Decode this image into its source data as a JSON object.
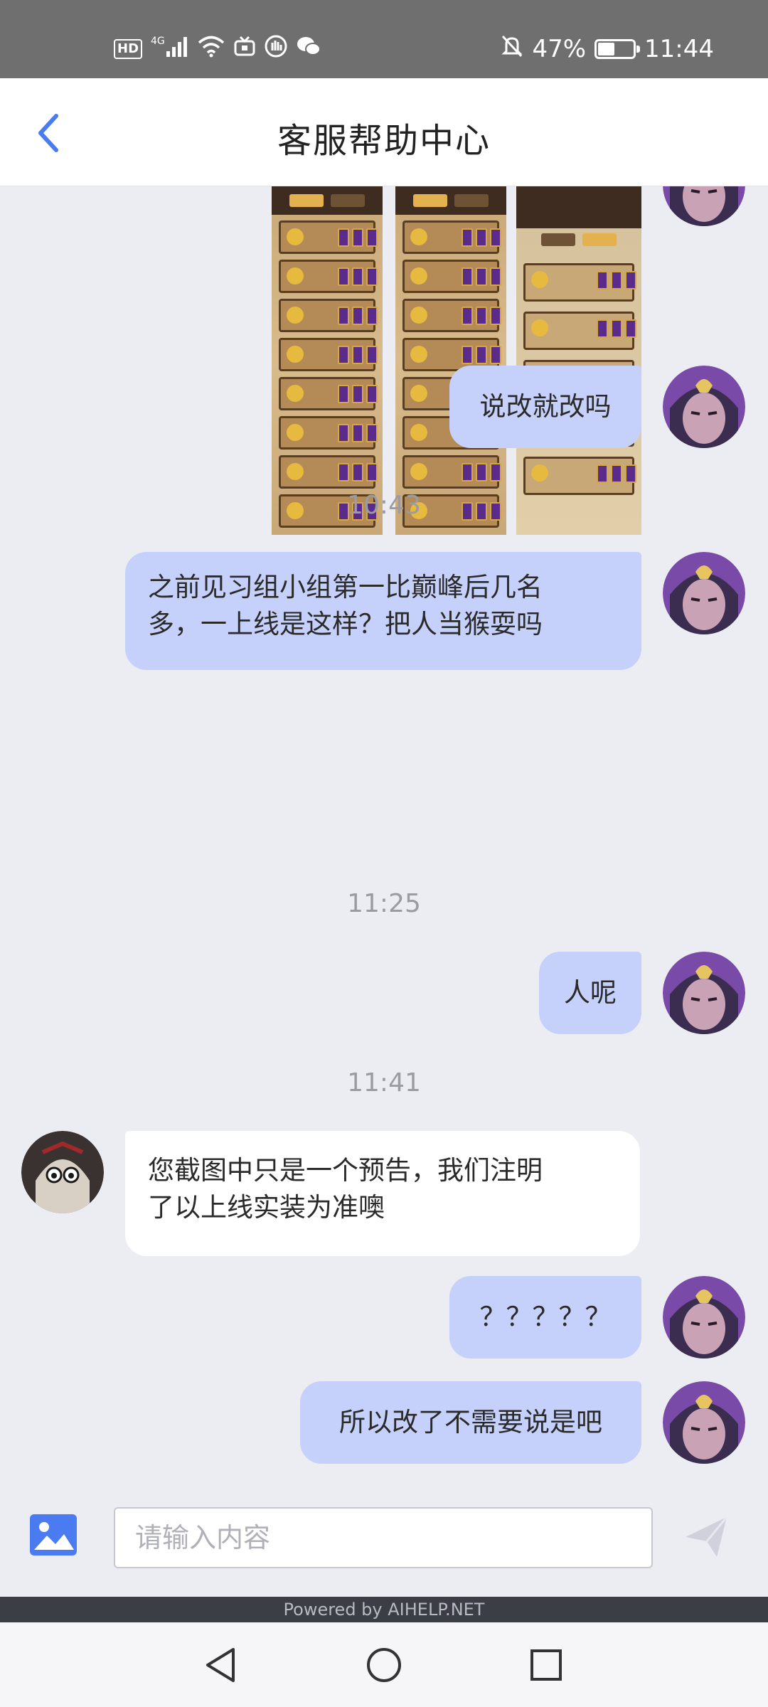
{
  "status_bar": {
    "hd": "HD",
    "network": "4G",
    "battery": "47%",
    "battery_level": 0.47,
    "time": "11:44"
  },
  "header": {
    "title": "客服帮助中心",
    "back_icon": "chevron-left-icon"
  },
  "messages": [
    {
      "type": "image",
      "sender": "user"
    },
    {
      "type": "text",
      "sender": "user",
      "text": "说改就改吗"
    },
    {
      "type": "time",
      "text": "10:43"
    },
    {
      "type": "text",
      "sender": "user",
      "line1": "之前见习组小组第一比巅峰后几名",
      "line2": "多，一上线是这样？把人当猴耍吗"
    },
    {
      "type": "time",
      "text": "11:25"
    },
    {
      "type": "text",
      "sender": "user",
      "text": "人呢"
    },
    {
      "type": "time",
      "text": "11:41"
    },
    {
      "type": "text",
      "sender": "support",
      "line1": "您截图中只是一个预告，我们注明",
      "line2": "了以上线实装为准噢"
    },
    {
      "type": "text",
      "sender": "user",
      "text": "？？？？？"
    },
    {
      "type": "text",
      "sender": "user",
      "text": "所以改了不需要说是吧"
    }
  ],
  "input": {
    "placeholder": "请输入内容",
    "image_icon": "image-icon",
    "send_icon": "send-icon"
  },
  "footer": {
    "powered_by": "Powered by AIHELP.NET"
  },
  "colors": {
    "my_bubble": "#c5d0fb",
    "support_bubble": "#ffffff",
    "accent": "#4a7bf0",
    "background": "#ececf3"
  }
}
